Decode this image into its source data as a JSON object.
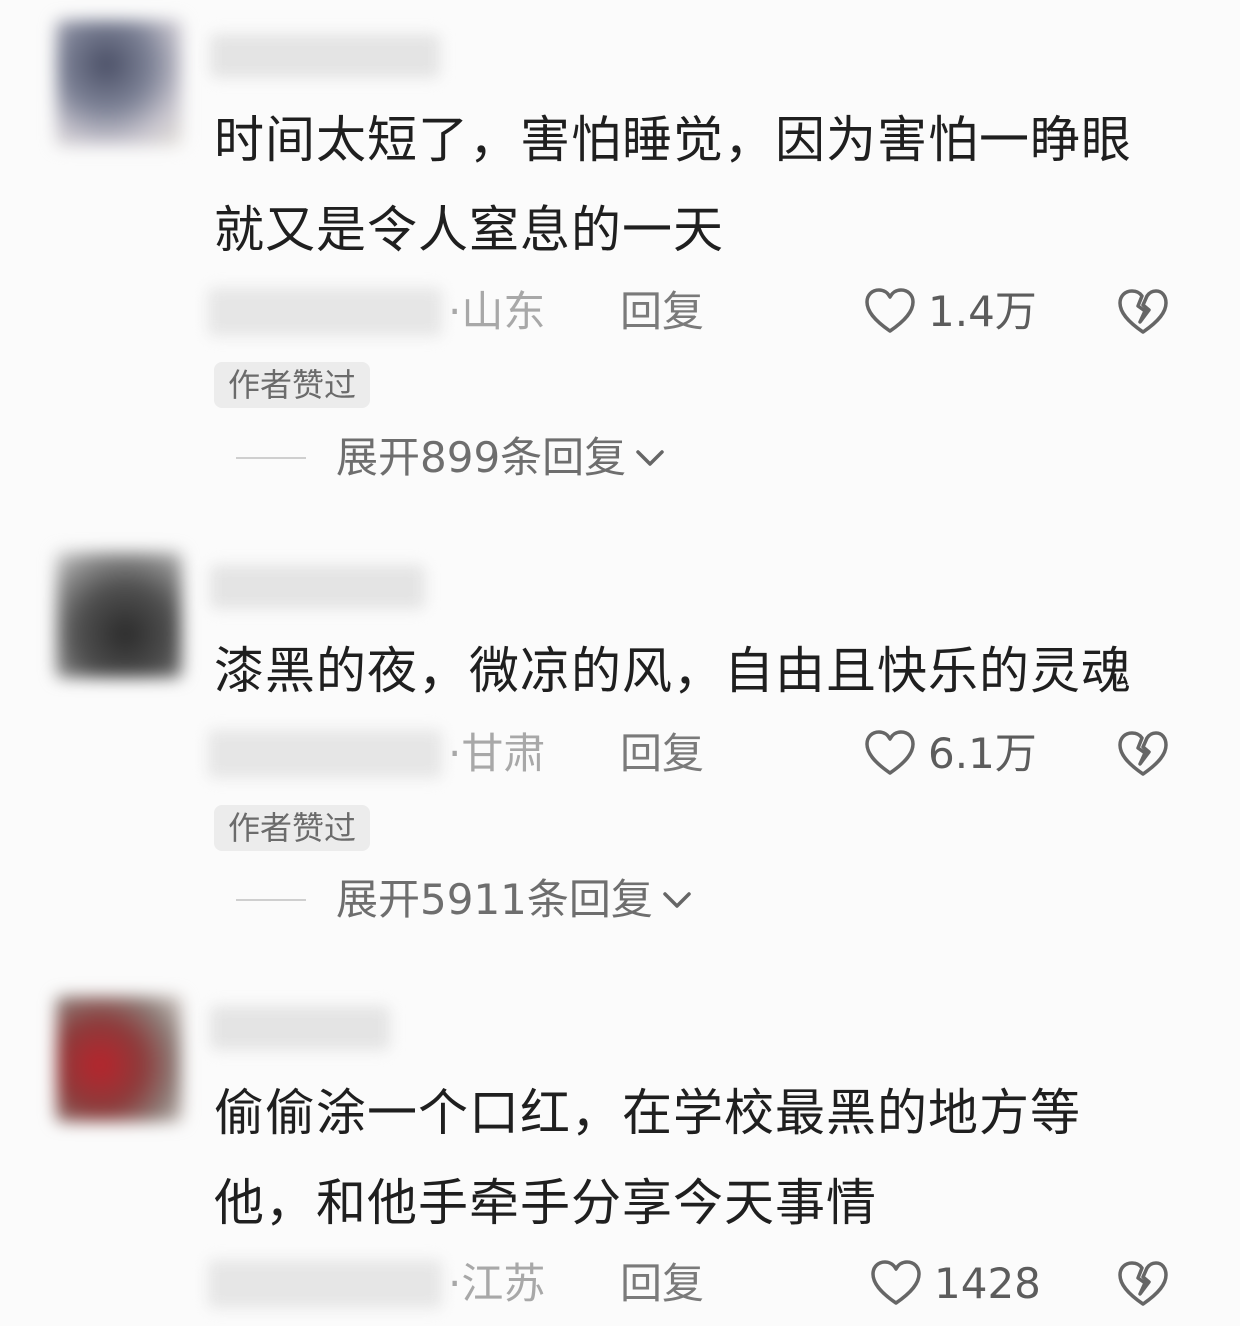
{
  "comments": [
    {
      "text_lines": [
        "时间太短了，害怕睡觉，因为害怕一睁眼",
        "就又是令人窒息的一天"
      ],
      "location": "·山东",
      "reply_label": "回复",
      "likes": "1.4万",
      "author_liked_badge": "作者赞过",
      "expand_label": "展开899条回复"
    },
    {
      "text_lines": [
        "漆黑的夜，微凉的风，自由且快乐的灵魂"
      ],
      "location": "·甘肃",
      "reply_label": "回复",
      "likes": "6.1万",
      "author_liked_badge": "作者赞过",
      "expand_label": "展开5911条回复"
    },
    {
      "text_lines": [
        "偷偷涂一个口红，在学校最黑的地方等",
        "他，和他手牵手分享今天事情"
      ],
      "location": "·江苏",
      "reply_label": "回复",
      "likes": "1428"
    }
  ],
  "icons": {
    "like": "heart-outline-icon",
    "dislike": "broken-heart-icon",
    "expand": "chevron-down-icon"
  },
  "colors": {
    "background": "#fbfbfb",
    "primary_text": "#1f1f1f",
    "secondary_text": "#7a7a7a",
    "location_text": "#a8a8a8",
    "badge_bg": "#ececec"
  }
}
